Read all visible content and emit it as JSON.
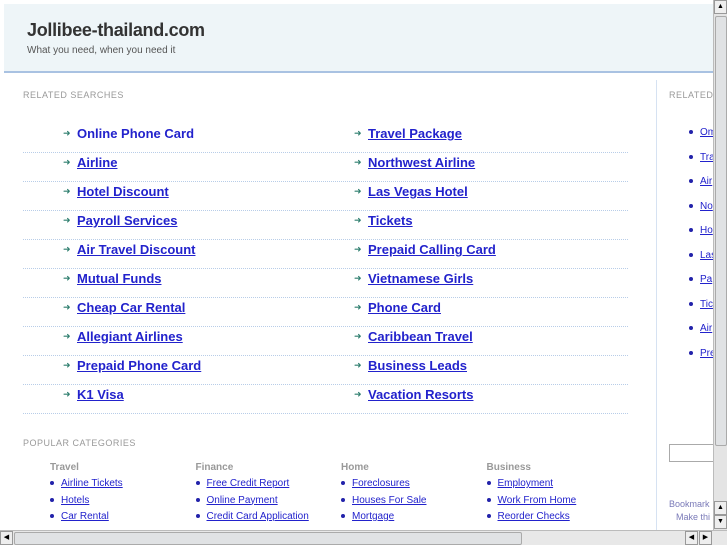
{
  "header": {
    "title": "Jollibee-thailand.com",
    "tagline": "What you need, when you need it"
  },
  "related": {
    "label": "RELATED SEARCHES",
    "left": [
      "Online Phone Card",
      "Airline",
      "Hotel Discount",
      "Payroll Services",
      "Air Travel Discount",
      "Mutual Funds",
      "Cheap Car Rental",
      "Allegiant Airlines",
      "Prepaid Phone Card",
      "K1 Visa"
    ],
    "right": [
      "Travel Package",
      "Northwest Airline",
      "Las Vegas Hotel",
      "Tickets",
      "Prepaid Calling Card",
      "Vietnamese Girls",
      "Phone Card",
      "Caribbean Travel",
      "Business Leads",
      "Vacation Resorts"
    ]
  },
  "sidebar": {
    "label": "RELATED",
    "items": [
      "Om",
      "Tra",
      "Air",
      "No",
      "Ho",
      "Las",
      "Pa",
      "Tic",
      "Air",
      "Pre"
    ],
    "bookmark": "Bookmark",
    "make": "Make thi"
  },
  "popular": {
    "label": "POPULAR CATEGORIES",
    "categories": [
      {
        "title": "Travel",
        "items": [
          "Airline Tickets",
          "Hotels",
          "Car Rental"
        ]
      },
      {
        "title": "Finance",
        "items": [
          "Free Credit Report",
          "Online Payment",
          "Credit Card Application"
        ]
      },
      {
        "title": "Home",
        "items": [
          "Foreclosures",
          "Houses For Sale",
          "Mortgage"
        ]
      },
      {
        "title": "Business",
        "items": [
          "Employment",
          "Work From Home",
          "Reorder Checks"
        ]
      }
    ]
  },
  "colors": {
    "link": "#2222cc",
    "header_bg": "#eef5f8",
    "arrow": "#2f7f6f"
  }
}
